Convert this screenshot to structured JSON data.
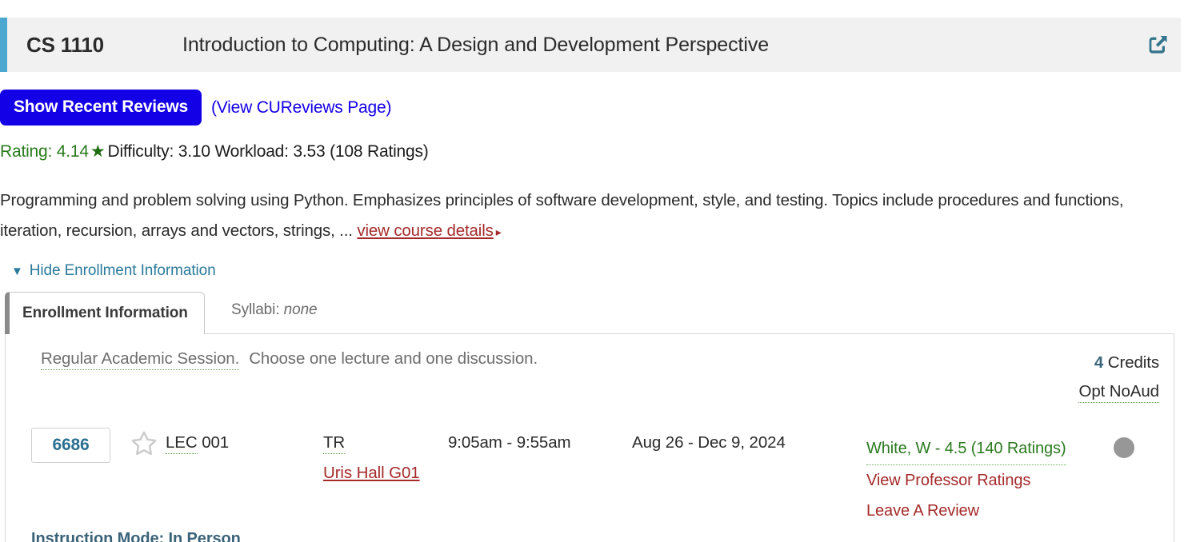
{
  "header": {
    "course_code": "CS 1110",
    "course_title": "Introduction to Computing: A Design and Development Perspective",
    "share_icon": "external-link-share-icon",
    "accent_color": "#4ba7cf",
    "background": "#f1f1f1"
  },
  "actions": {
    "show_recent_reviews": "Show Recent Reviews",
    "view_cureviews_page": "(View CUReviews Page)",
    "button_color": "#1400e6"
  },
  "ratings": {
    "rating_text": "Rating: 4.14",
    "star": "★",
    "difficulty_workload_text": "Difficulty: 3.10 Workload: 3.53 (108 Ratings)",
    "rating_color": "#2a7a1e",
    "rating_value": "4.14",
    "difficulty_value": "3.10",
    "workload_value": "3.53",
    "ratings_count": "108 Ratings"
  },
  "description": {
    "text": "Programming and problem solving using Python. Emphasizes principles of software development, style, and testing. Topics include procedures and functions, iteration, recursion, arrays and vectors, strings, ... ",
    "details_link": "view course details",
    "caret": "▸",
    "link_color": "#a52a2a"
  },
  "enrollment_toggle": {
    "arrow": "▼",
    "label": "Hide Enrollment Information",
    "color": "#2c7a9b"
  },
  "tabs": {
    "active_tab": "Enrollment Information",
    "syllabi_label": "Syllabi:",
    "syllabi_value": "none"
  },
  "panel": {
    "session": "Regular Academic Session.",
    "session_note": "Choose one lecture and one discussion.",
    "credits_number": "4",
    "credits_label": "Credits",
    "grading_option": "Opt NoAud",
    "class": {
      "class_number": "6686",
      "favorite_icon": "star-outline-icon",
      "section_type": "LEC",
      "section_number": "001",
      "meeting_days": "TR",
      "meeting_time": "9:05am - 9:55am",
      "meeting_dates": "Aug 26 - Dec 9, 2024",
      "location": "Uris Hall G01",
      "instructor": "White, W - 4.5 (140 Ratings)",
      "view_professor_ratings": "View Professor Ratings",
      "leave_a_review": "Leave A Review",
      "status_dot_color": "#979797"
    },
    "instruction_mode": "Instruction Mode: In Person"
  }
}
